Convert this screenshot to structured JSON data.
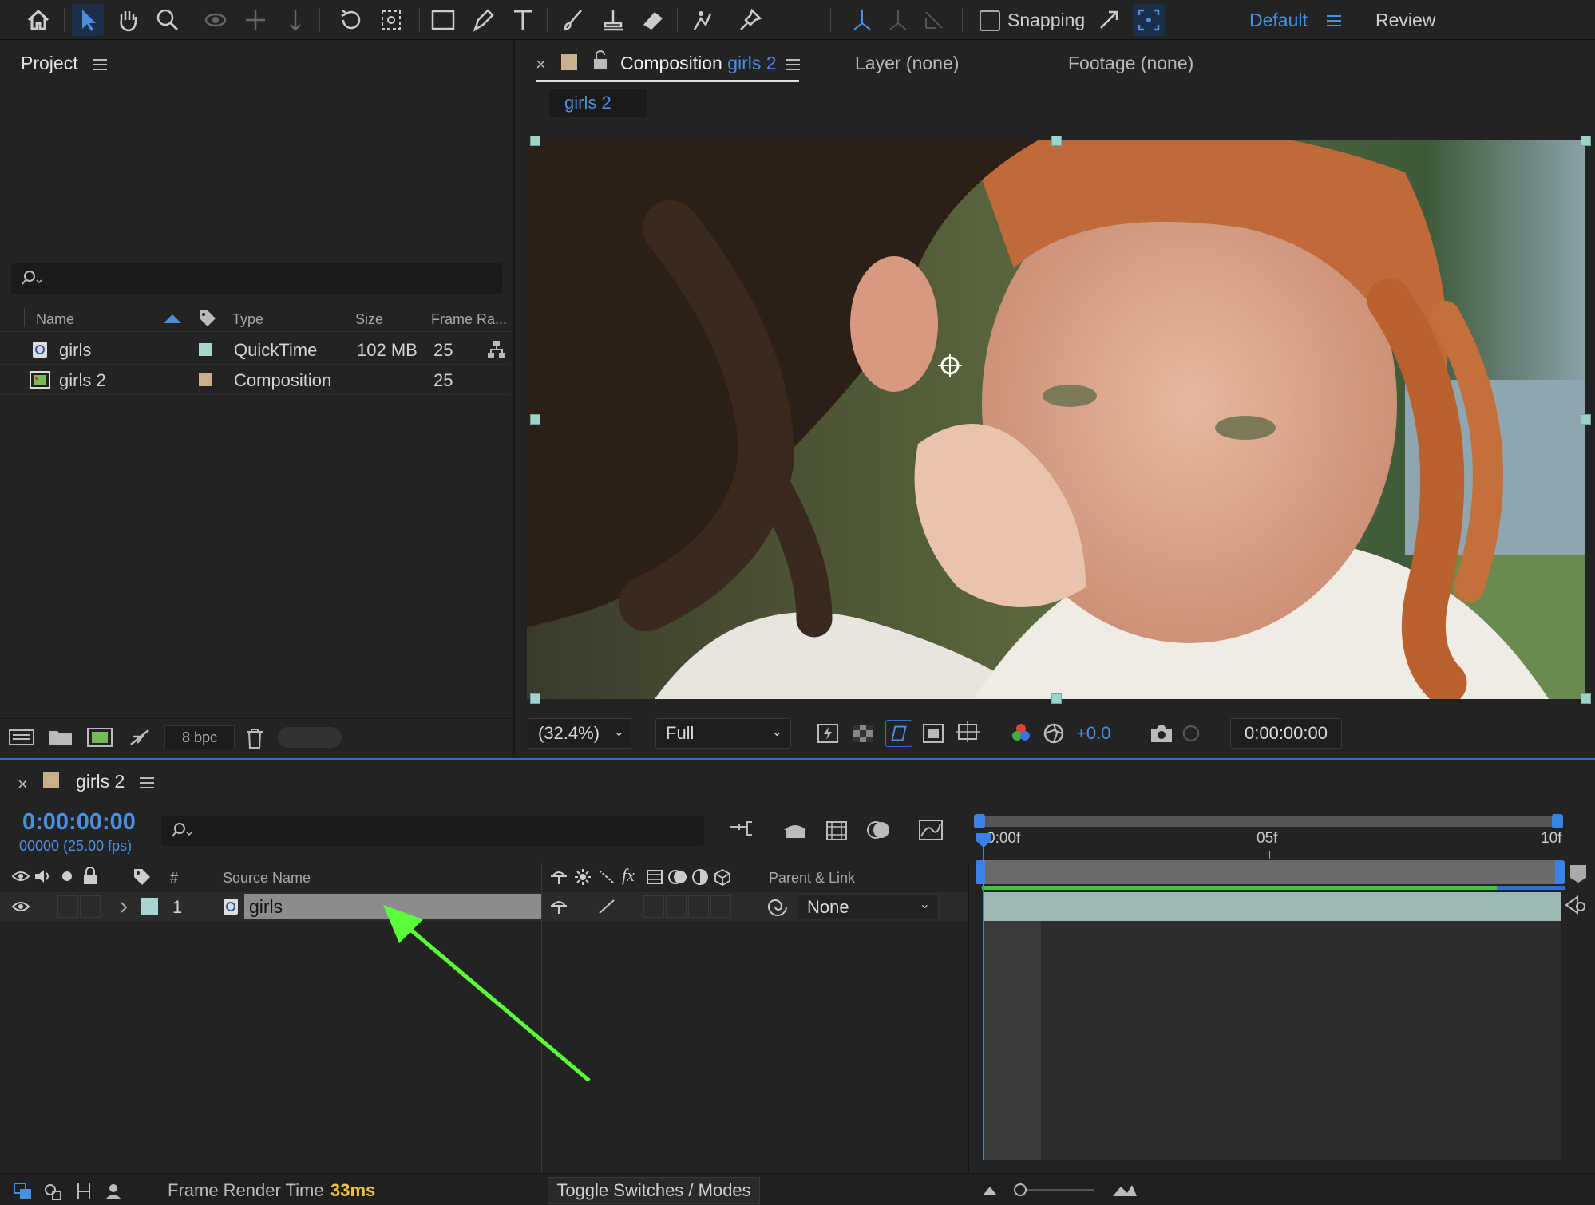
{
  "workspace": {
    "default_label": "Default",
    "review_label": "Review",
    "snapping_label": "Snapping",
    "accent": "#4a90e2"
  },
  "project": {
    "title": "Project",
    "columns": [
      "Name",
      "Type",
      "Size",
      "Frame Ra..."
    ],
    "items": [
      {
        "name": "girls",
        "type": "QuickTime",
        "size": "102 MB",
        "frame_rate": "25",
        "label_color": "#a6d6cf"
      },
      {
        "name": "girls 2",
        "type": "Composition",
        "size": "",
        "frame_rate": "25",
        "label_color": "#c8b08a"
      }
    ],
    "bpc": "8 bpc"
  },
  "composition": {
    "tab_prefix": "Composition",
    "tab_name": "girls 2",
    "layer_tab": "Layer (none)",
    "footage_tab": "Footage (none)",
    "breadcrumb": "girls 2",
    "zoom": "(32.4%)",
    "resolution": "Full",
    "exposure": "+0.0",
    "timecode": "0:00:00:00"
  },
  "timeline": {
    "comp_name": "girls 2",
    "timecode": "0:00:00:00",
    "frames": "00000 (25.00 fps)",
    "columns": {
      "number": "#",
      "source_name": "Source Name",
      "parent": "Parent & Link"
    },
    "ruler": [
      "0:00f",
      "05f",
      "10f"
    ],
    "layers": [
      {
        "index": "1",
        "name": "girls",
        "parent": "None",
        "label_color": "#a6d6cf"
      }
    ],
    "frame_render_label": "Frame Render Time",
    "frame_render_value": "33ms",
    "toggle_label": "Toggle Switches / Modes"
  }
}
